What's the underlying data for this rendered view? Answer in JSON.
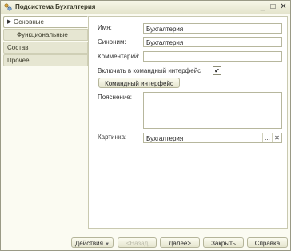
{
  "window": {
    "title": "Подсистема Бухгалтерия",
    "minimize": "_",
    "maximize": "□",
    "close": "✕"
  },
  "sidebar": {
    "items": [
      {
        "label": "Основные",
        "active": true
      },
      {
        "label": "Функциональные опции",
        "active": false
      },
      {
        "label": "Состав",
        "active": false
      },
      {
        "label": "Прочее",
        "active": false
      }
    ]
  },
  "form": {
    "name_label": "Имя:",
    "name_value": "Бухгалтерия",
    "synonym_label": "Синоним:",
    "synonym_value": "Бухгалтерия",
    "comment_label": "Комментарий:",
    "comment_value": "",
    "include_label": "Включать в командный интерфейс",
    "include_checked": true,
    "check_mark": "✔",
    "command_button": "Командный интерфейс",
    "explanation_label": "Пояснение:",
    "picture_label": "Картинка:",
    "picture_value": "Бухгалтерия",
    "picture_select": "...",
    "picture_clear": "✕"
  },
  "footer": {
    "actions": "Действия",
    "actions_arrow": "▼",
    "back": "<Назад",
    "next": "Далее>",
    "close": "Закрыть",
    "help": "Справка"
  },
  "colors": {
    "title_bg": "#e4e4cc",
    "panel_bg": "#fbfbf2",
    "border": "#b7b79d"
  }
}
